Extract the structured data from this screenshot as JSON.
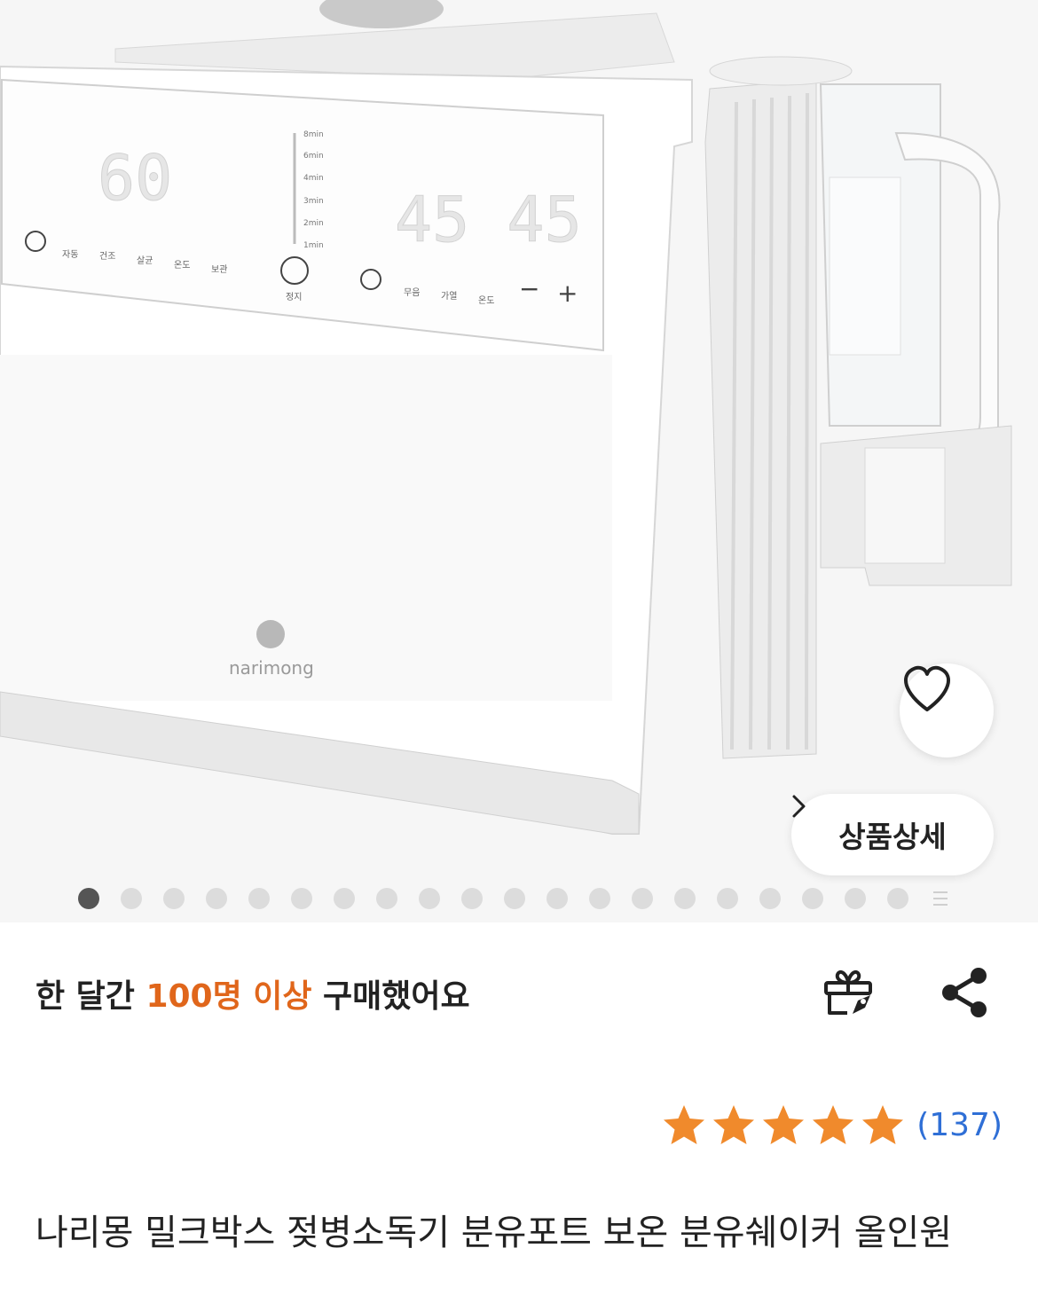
{
  "product_image": {
    "brand_logo_text": "narimong",
    "display_left_number": "60",
    "display_right_number": "45 45",
    "control_labels": [
      "자동",
      "건조",
      "살균",
      "온도",
      "보관",
      "정지",
      "무음",
      "가열",
      "온도"
    ],
    "timer_labels": [
      "8min",
      "6min",
      "4min",
      "3min",
      "2min",
      "1min"
    ],
    "minus_label": "−",
    "plus_label": "+"
  },
  "wishlist": {
    "icon": "heart-icon"
  },
  "detail_button": {
    "label": "상품상세",
    "icon": "chevron-right-icon"
  },
  "carousel": {
    "total_dots": 20,
    "active_index": 0,
    "more_icon": "more-icon"
  },
  "purchase_info": {
    "prefix": "한 달간 ",
    "highlight": "100명 이상",
    "suffix": " 구매했어요",
    "highlight_color": "#e0661b"
  },
  "actions": {
    "gift_icon": "gift-icon",
    "share_icon": "share-icon"
  },
  "rating": {
    "stars": 5,
    "review_count": "(137)",
    "star_color": "#f08a2c",
    "link_color": "#2f6fd6"
  },
  "product": {
    "title": "나리몽 밀크박스 젖병소독기 분유포트 보온 분유쉐이커 올인원"
  }
}
